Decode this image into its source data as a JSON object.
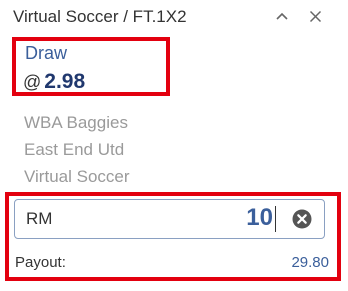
{
  "header": {
    "title": "Virtual Soccer / FT.1X2",
    "collapse_icon": "chevron-up-icon",
    "close_icon": "close-icon"
  },
  "selection": {
    "name": "Draw",
    "odds_prefix": "@",
    "odds": "2.98"
  },
  "details": {
    "home_team": "WBA Baggies",
    "away_team": "East End Utd",
    "sport": "Virtual Soccer"
  },
  "stake": {
    "currency": "RM",
    "value": "10",
    "clear_icon": "clear-circle-icon"
  },
  "payout": {
    "label": "Payout:",
    "value": "29.80"
  },
  "colors": {
    "highlight_border": "#e3000f",
    "accent": "#3b5f9b",
    "odds": "#20386e",
    "muted_text": "#9a9a9a"
  }
}
